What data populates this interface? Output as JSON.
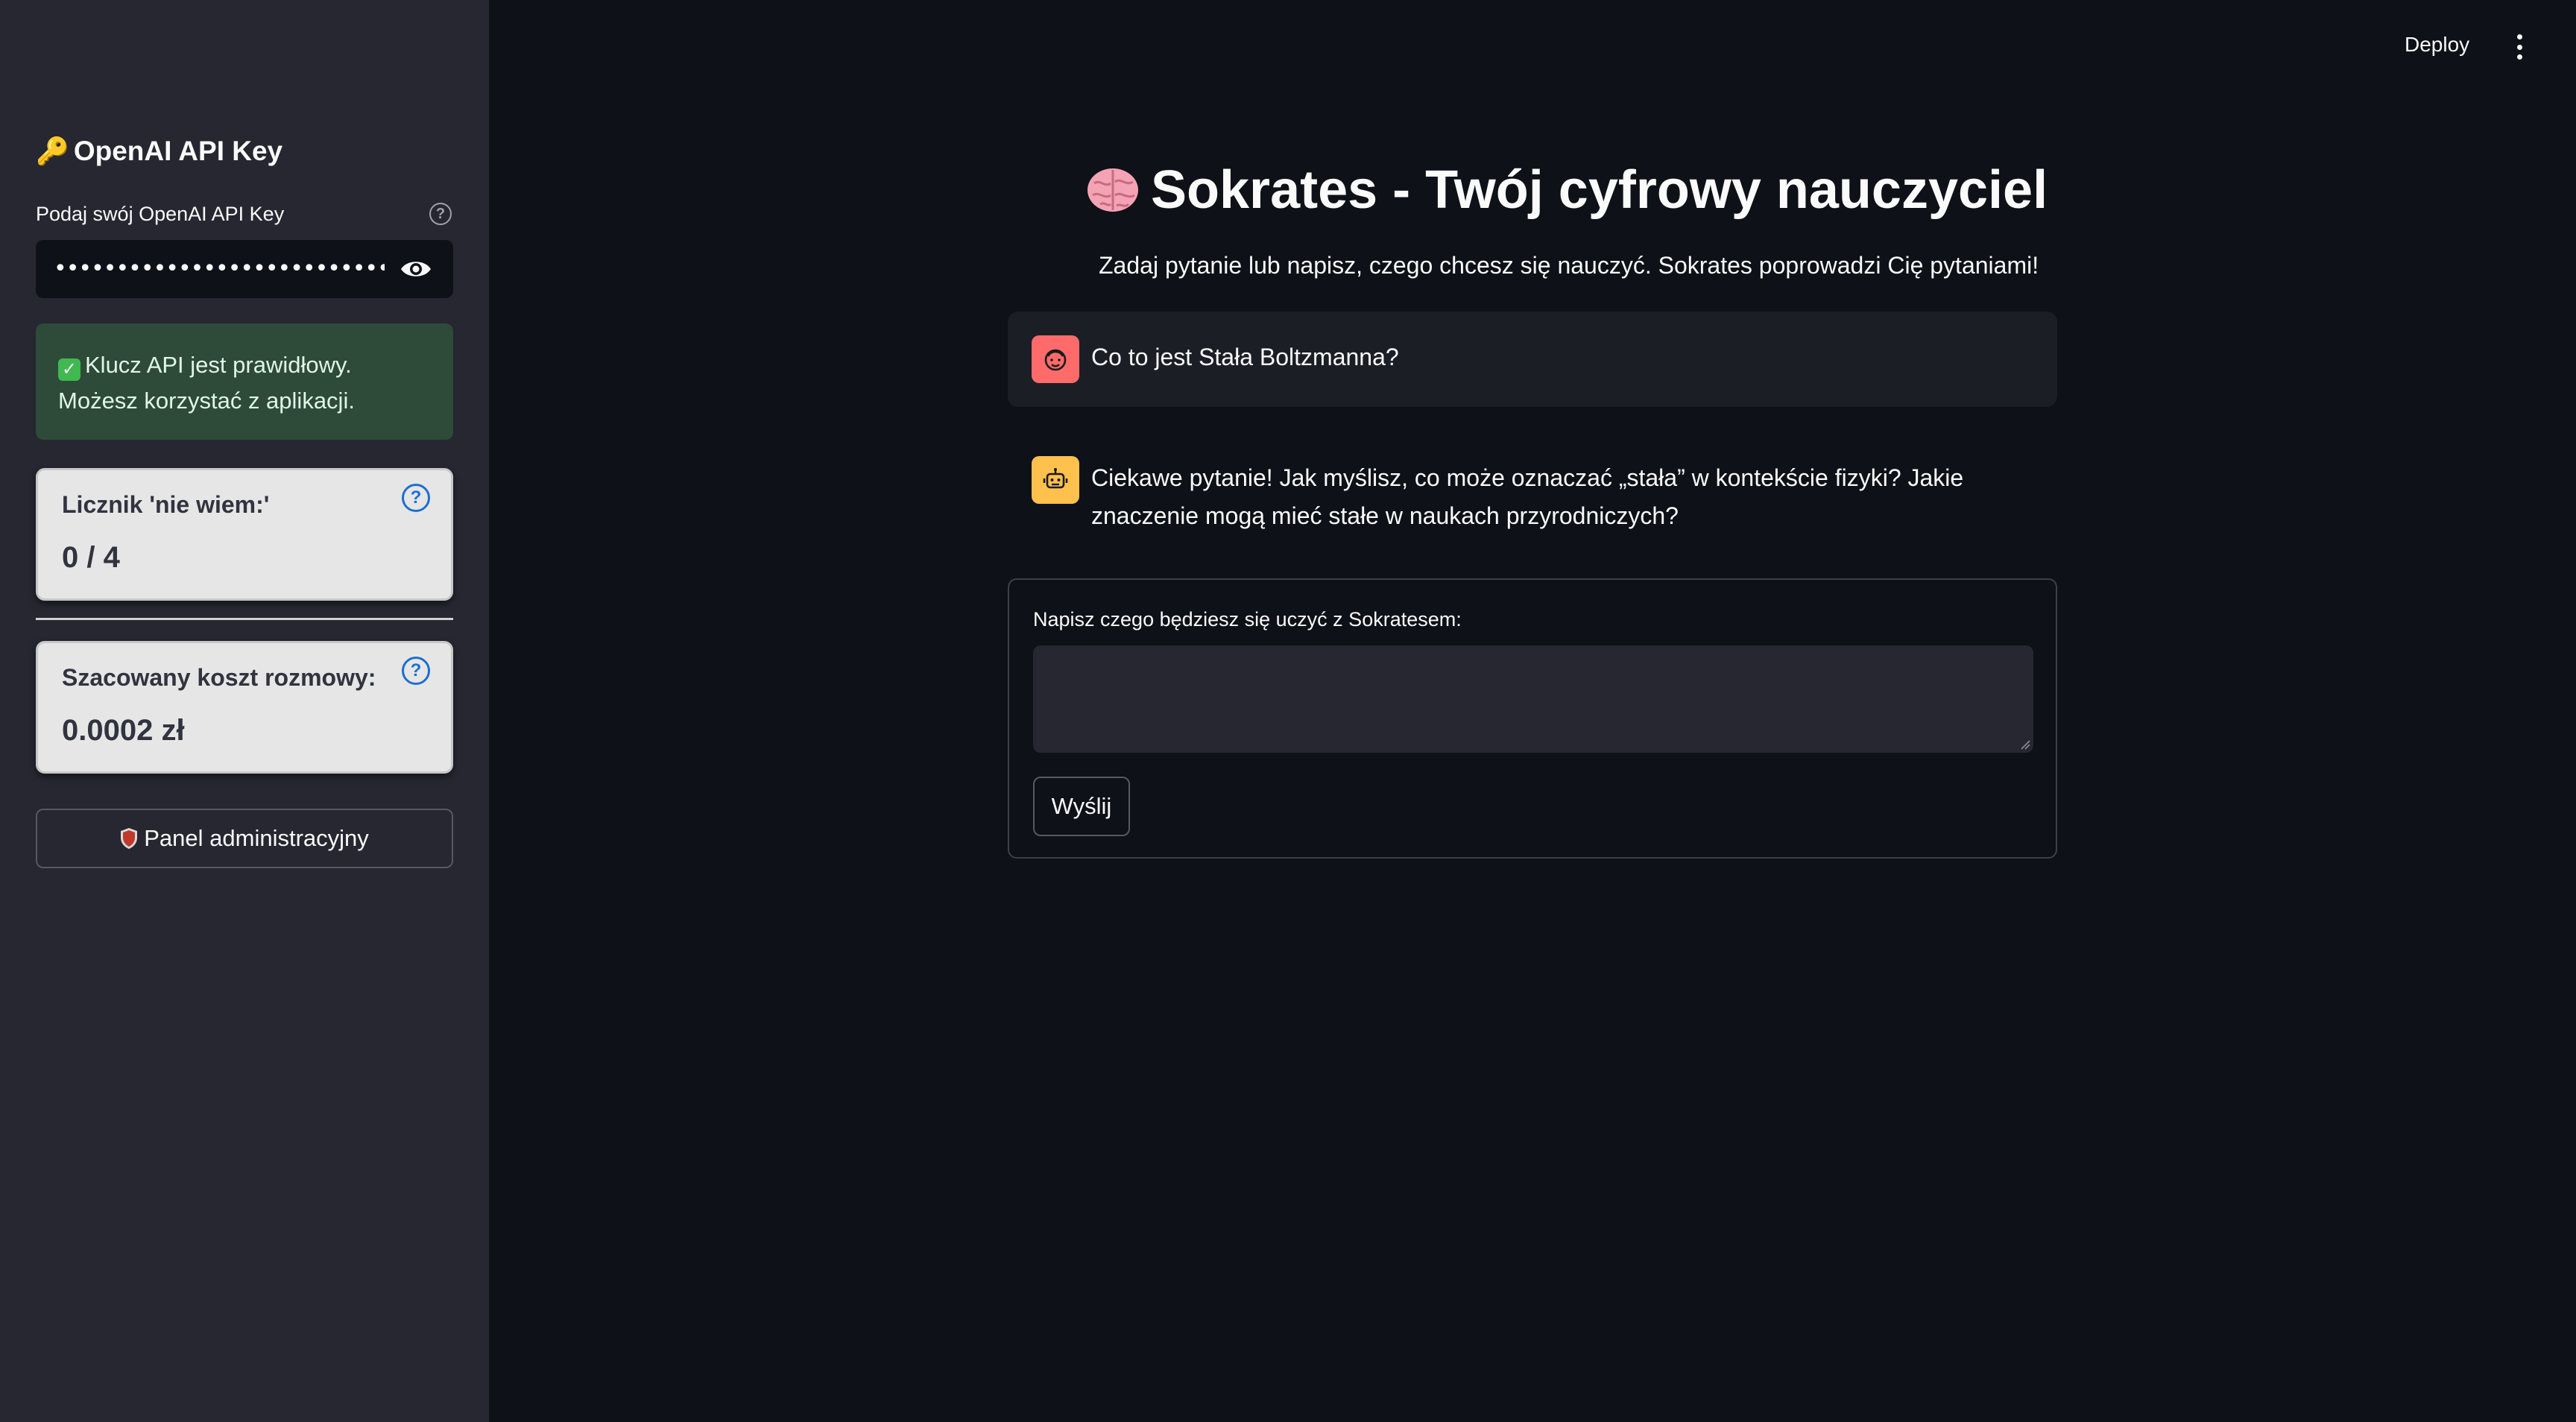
{
  "sidebar": {
    "title_emoji": "🔑",
    "title": "OpenAI API Key",
    "key_label": "Podaj swój OpenAI API Key",
    "key_value_masked": "••••••••••••••••••••••••••••••••••••••••••••••",
    "success_message": "Klucz API jest prawidłowy. Możesz korzystać z aplikacji.",
    "metrics": [
      {
        "label": "Licznik 'nie wiem:'",
        "value": "0 / 4"
      },
      {
        "label": "Szacowany koszt rozmowy:",
        "value": "0.0002 zł"
      }
    ],
    "admin_button": "Panel administracyjny"
  },
  "header": {
    "deploy_label": "Deploy"
  },
  "main": {
    "title": "Sokrates - Twój cyfrowy nauczyciel",
    "subtitle": "Zadaj pytanie lub napisz, czego chcesz się nauczyć. Sokrates poprowadzi Cię pytaniami!",
    "messages": [
      {
        "role": "user",
        "text": "Co to jest Stała Boltzmanna?"
      },
      {
        "role": "assistant",
        "text": "Ciekawe pytanie! Jak myślisz, co może oznaczać „stała” w kontekście fizyki? Jakie znaczenie mogą mieć stałe w naukach przyrodniczych?"
      }
    ],
    "form": {
      "label": "Napisz czego będziesz się uczyć z Sokratesem:",
      "input_value": "",
      "submit_label": "Wyślij"
    }
  },
  "colors": {
    "sidebar_bg": "#262730",
    "main_bg": "#0e1117",
    "success_bg": "#2e4a38",
    "user_avatar": "#ff6b6b",
    "bot_avatar": "#ffc14d",
    "help_blue": "#1c6fd1"
  }
}
